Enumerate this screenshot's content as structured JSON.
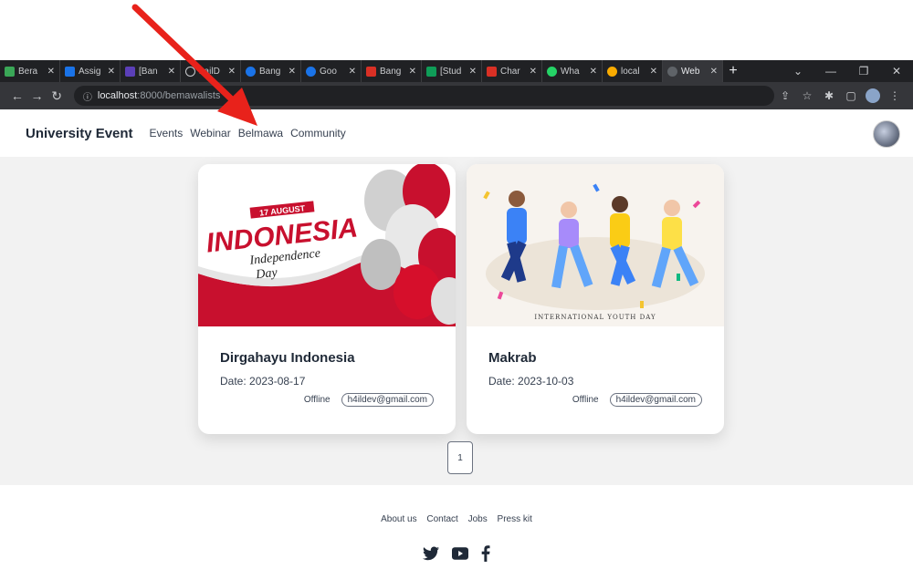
{
  "browser": {
    "tabs": [
      {
        "label": "Bera",
        "color": "#3aa757"
      },
      {
        "label": "Assig",
        "color": "#1a73e8"
      },
      {
        "label": "[Ban",
        "color": "#5b3fb8"
      },
      {
        "label": "hailD",
        "color": "#ffffff"
      },
      {
        "label": "Bang",
        "color": "#1a73e8"
      },
      {
        "label": "Goo",
        "color": "#1a73e8"
      },
      {
        "label": "Bang",
        "color": "#d93025"
      },
      {
        "label": "[Stud",
        "color": "#0f9d58"
      },
      {
        "label": "Char",
        "color": "#d93025"
      },
      {
        "label": "Wha",
        "color": "#25d366"
      },
      {
        "label": "local",
        "color": "#f9ab00"
      },
      {
        "label": "Web",
        "color": "#5f6368"
      }
    ],
    "tab_close": "✕",
    "new_tab": "+",
    "url_host": "localhost",
    "url_path": ":8000/bemawalists"
  },
  "nav": {
    "brand": "University Event",
    "links": [
      "Events",
      "Webinar",
      "Belmawa",
      "Community"
    ]
  },
  "events": [
    {
      "title": "Dirgahayu Indonesia",
      "date": "Date: 2023-08-17",
      "mode": "Offline",
      "email": "h4ildev@gmail.com",
      "image_text_top": "17 AUGUST",
      "image_text_main": "INDONESIA",
      "image_text_sub1": "Independence",
      "image_text_sub2": "Day"
    },
    {
      "title": "Makrab",
      "date": "Date: 2023-10-03",
      "mode": "Offline",
      "email": "h4ildev@gmail.com",
      "image_text_bottom": "INTERNATIONAL YOUTH DAY"
    }
  ],
  "pagination": {
    "current": "1"
  },
  "footer": {
    "links": [
      "About us",
      "Contact",
      "Jobs",
      "Press kit"
    ]
  },
  "colors": {
    "accent_red": "#e8221b",
    "indonesia_red": "#c8102e"
  }
}
